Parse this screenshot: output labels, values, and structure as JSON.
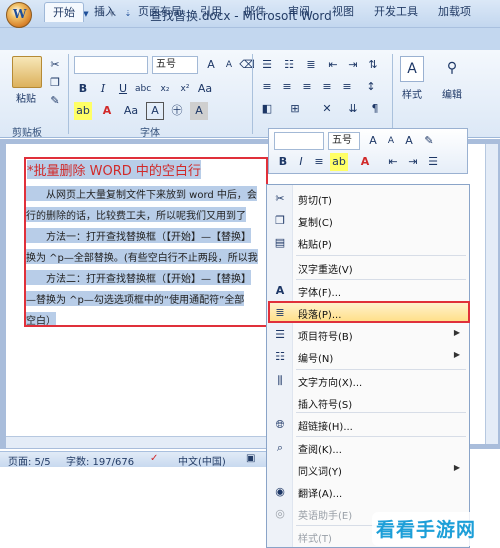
{
  "window": {
    "title": "查找替换.docx - Microsoft Word"
  },
  "tabs": [
    "开始",
    "插入",
    "页面布局",
    "引用",
    "邮件",
    "审阅",
    "视图",
    "开发工具",
    "加载项"
  ],
  "ribbon": {
    "clipboard": {
      "paste_label": "粘贴",
      "group_label": "剪贴板"
    },
    "font": {
      "size_value": "五号",
      "group_label": "字体"
    },
    "styles": {
      "label": "样式"
    },
    "editing": {
      "label": "编辑"
    }
  },
  "mini_toolbar": {
    "size_value": "五号"
  },
  "document": {
    "heading": "*批量删除 WORD 中的空白行",
    "lines": [
      "　　从网页上大量复制文件下来放到 word 中后，会",
      "行的删除的话，比较费工夫，所以呢我们又用到了",
      "　　方法一：打开查找替换框（【开始】—【替换】",
      "换为 ^p—全部替换。(有些空白行不止两段，所以我",
      "　　方法二：打开查找替换框（【开始】—【替换】",
      "—替换为 ^p—勾选选项框中的“使用通配符”全部",
      "空白）"
    ]
  },
  "context_menu": {
    "items": [
      {
        "label": "剪切(T)",
        "icon": "scissors-icon",
        "disabled": false,
        "submenu": false
      },
      {
        "label": "复制(C)",
        "icon": "copy-icon",
        "disabled": false,
        "submenu": false
      },
      {
        "label": "粘贴(P)",
        "icon": "paste-icon",
        "disabled": false,
        "submenu": false
      },
      {
        "label": "汉字重选(V)",
        "icon": "",
        "disabled": false,
        "submenu": false
      },
      {
        "label": "字体(F)...",
        "icon": "font-icon",
        "disabled": false,
        "submenu": false
      },
      {
        "label": "段落(P)...",
        "icon": "paragraph-icon",
        "disabled": false,
        "submenu": false
      },
      {
        "label": "项目符号(B)",
        "icon": "bullets-icon",
        "disabled": false,
        "submenu": true
      },
      {
        "label": "编号(N)",
        "icon": "numbering-icon",
        "disabled": false,
        "submenu": true
      },
      {
        "label": "文字方向(X)...",
        "icon": "text-direction-icon",
        "disabled": false,
        "submenu": false
      },
      {
        "label": "插入符号(S)",
        "icon": "",
        "disabled": false,
        "submenu": false
      },
      {
        "label": "超链接(H)...",
        "icon": "hyperlink-icon",
        "disabled": false,
        "submenu": false
      },
      {
        "label": "查阅(K)...",
        "icon": "lookup-icon",
        "disabled": false,
        "submenu": false
      },
      {
        "label": "同义词(Y)",
        "icon": "",
        "disabled": false,
        "submenu": true
      },
      {
        "label": "翻译(A)...",
        "icon": "translate-icon",
        "disabled": false,
        "submenu": false
      },
      {
        "label": "英语助手(E)",
        "icon": "english-assistant-icon",
        "disabled": true,
        "submenu": false
      },
      {
        "label": "样式(T)",
        "icon": "",
        "disabled": true,
        "submenu": false
      }
    ]
  },
  "status": {
    "page": "页面: 5/5",
    "words": "字数: 197/676",
    "language": "中文(中国)"
  },
  "watermark": "看看手游网",
  "colors": {
    "selection_outline": "#e0303a",
    "heading": "#d12a2a",
    "selection_bg": "#b8cde8"
  }
}
